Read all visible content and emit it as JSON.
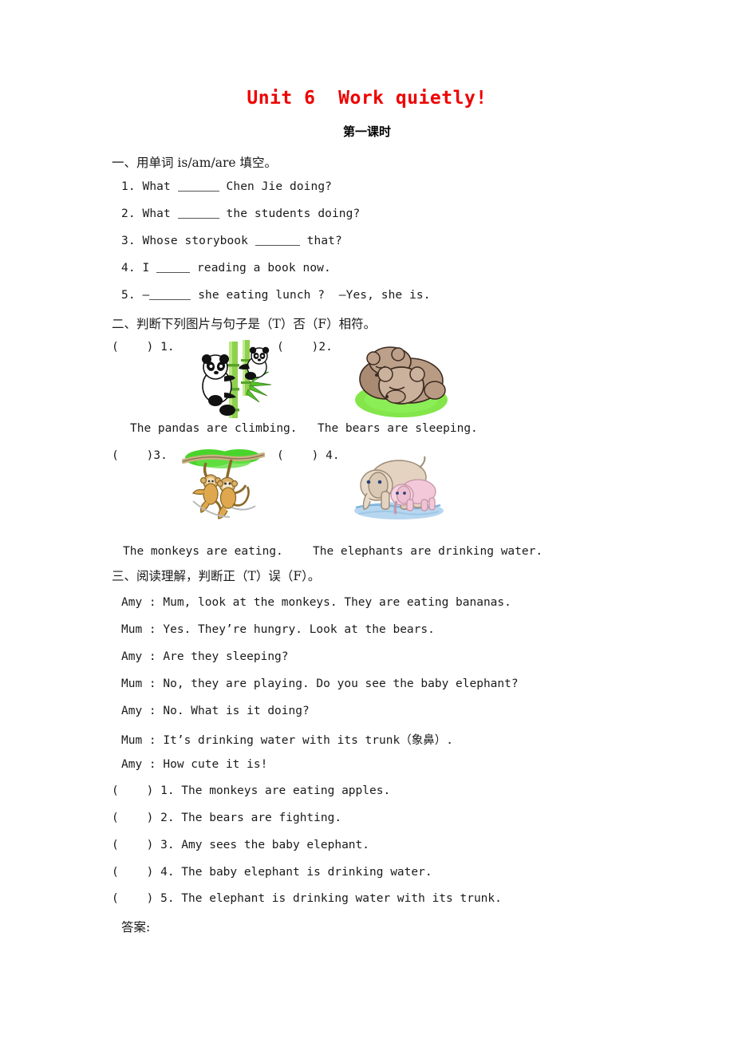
{
  "document": {
    "title": "Unit 6  Work quietly!",
    "subtitle": "第一课时",
    "title_color": "#ee0000",
    "answer_label": "答案:"
  },
  "section1": {
    "heading": "一、用单词 is/am/are 填空。",
    "items": [
      {
        "num": "1.",
        "before": "What",
        "after": "Chen Jie doing?",
        "blank_width": 52
      },
      {
        "num": "2.",
        "before": "What",
        "after": "the students doing?",
        "blank_width": 52
      },
      {
        "num": "3.",
        "before": "Whose storybook",
        "after": "that?",
        "blank_width": 56
      },
      {
        "num": "4.",
        "before": "I",
        "after": "reading a book now.",
        "blank_width": 42
      },
      {
        "num": "5.",
        "before": "—",
        "after": "she eating lunch ?  —Yes, she is.",
        "blank_width": 52
      }
    ]
  },
  "section2": {
    "heading": "二、判断下列图片与句子是（T）否（F）相符。",
    "items": [
      {
        "mark": "(    ) 1.",
        "caption": "The pandas are climbing.",
        "image": "pandas-climbing-bamboo-image"
      },
      {
        "mark": "(    )2.",
        "caption": "The bears are sleeping.",
        "image": "bears-sleeping-image"
      },
      {
        "mark": "(    )3.",
        "caption": "The monkeys are eating.",
        "image": "monkeys-swinging-image"
      },
      {
        "mark": "(    ) 4.",
        "caption": "The elephants are drinking water.",
        "image": "elephants-drinking-water-image"
      }
    ]
  },
  "section3": {
    "heading": "三、阅读理解，判断正（T）误（F）。",
    "dialogue": [
      "Amy : Mum, look at the monkeys. They are eating bananas.",
      "Mum : Yes. They’re hungry. Look at the bears.",
      "Amy : Are they sleeping?",
      "Mum : No, they are playing. Do you see the baby elephant?",
      "Amy : No. What is it doing?",
      "Mum : It’s drinking water with its trunk（象鼻）.",
      "Amy : How cute it is!"
    ],
    "tf_items": [
      "(    ) 1. The monkeys are eating apples.",
      "(    ) 2. The bears are fighting.",
      "(    ) 3. Amy sees the baby elephant.",
      "(    ) 4. The baby elephant is drinking water.",
      "(    ) 5. The elephant is drinking water with its trunk."
    ]
  }
}
